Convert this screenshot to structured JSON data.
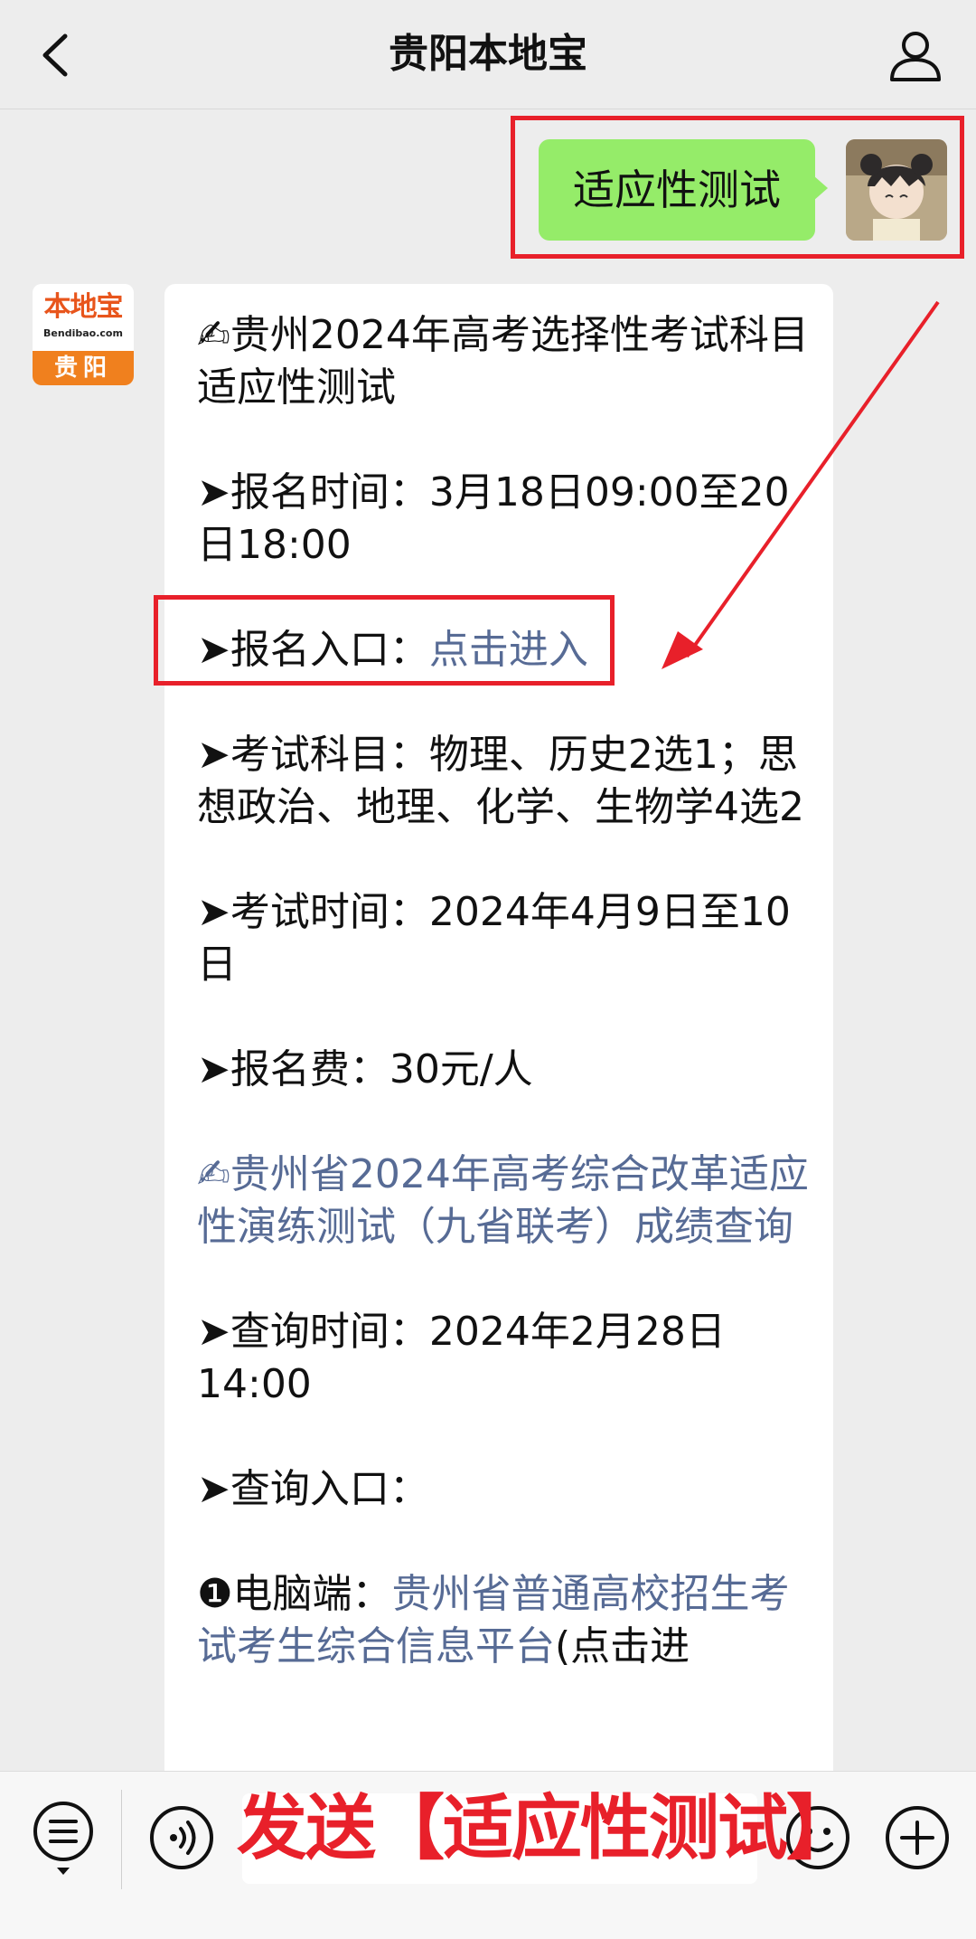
{
  "header": {
    "title": "贵阳本地宝"
  },
  "outgoing": {
    "text": "适应性测试"
  },
  "account_logo": {
    "main": "本地宝",
    "sub": "Bendibao.com",
    "city": "贵阳"
  },
  "message": {
    "section1_title": "✍贵州2024年高考选择性考试科目适应性测试",
    "reg_time": "➤报名时间：3月18日09:00至20日18:00",
    "reg_entry_label": "➤报名入口：",
    "reg_entry_link": "点击进入",
    "subjects": "➤考试科目：物理、历史2选1；思想政治、地理、化学、生物学4选2",
    "exam_time": "➤考试时间：2024年4月9日至10日",
    "fee": "➤报名费：30元/人",
    "section2_title": "✍贵州省2024年高考综合改革适应性演练测试（九省联考）成绩查询",
    "query_time": "➤查询时间：2024年2月28日14:00",
    "query_entry": "➤查询入口：",
    "pc_label": "❶电脑端：",
    "pc_link": "贵州省普通高校招生考试考生综合信息平台",
    "pc_suffix": "(点击进"
  },
  "overlay": {
    "text": "发送【适应性测试】"
  },
  "colors": {
    "background": "#ededed",
    "bubble_out": "#95ec69",
    "link": "#576b95",
    "annotation": "#e8202a",
    "logo_orange": "#f0801e"
  }
}
